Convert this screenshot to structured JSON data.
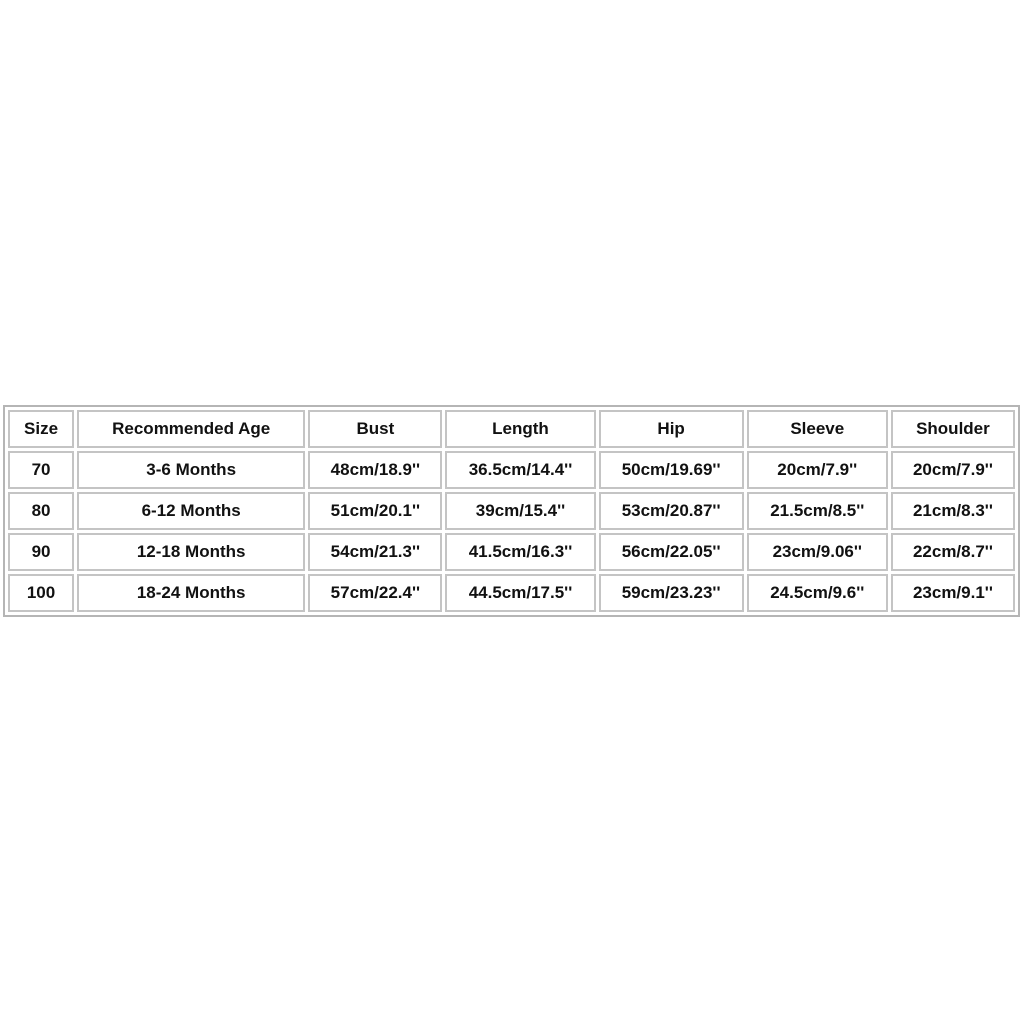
{
  "size_chart": {
    "headers": [
      "Size",
      "Recommended Age",
      "Bust",
      "Length",
      "Hip",
      "Sleeve",
      "Shoulder"
    ],
    "rows": [
      [
        "70",
        "3-6 Months",
        "48cm/18.9''",
        "36.5cm/14.4''",
        "50cm/19.69''",
        "20cm/7.9''",
        "20cm/7.9''"
      ],
      [
        "80",
        "6-12 Months",
        "51cm/20.1''",
        "39cm/15.4''",
        "53cm/20.87''",
        "21.5cm/8.5''",
        "21cm/8.3''"
      ],
      [
        "90",
        "12-18 Months",
        "54cm/21.3''",
        "41.5cm/16.3''",
        "56cm/22.05''",
        "23cm/9.06''",
        "22cm/8.7''"
      ],
      [
        "100",
        "18-24 Months",
        "57cm/22.4''",
        "44.5cm/17.5''",
        "59cm/23.23''",
        "24.5cm/9.6''",
        "23cm/9.1''"
      ]
    ]
  }
}
